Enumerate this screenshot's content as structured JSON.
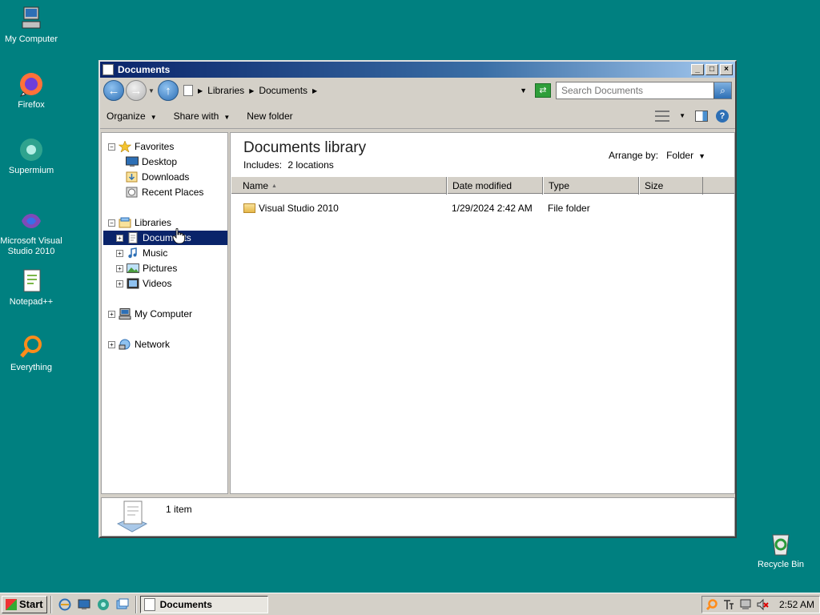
{
  "desktop": {
    "icons": [
      {
        "label": "My Computer"
      },
      {
        "label": "Firefox"
      },
      {
        "label": "Supermium"
      },
      {
        "label": "Microsoft Visual Studio 2010"
      },
      {
        "label": "Notepad++"
      },
      {
        "label": "Everything"
      },
      {
        "label": "Recycle Bin"
      }
    ]
  },
  "window": {
    "title": "Documents",
    "address": {
      "crumbs": [
        "Libraries",
        "Documents"
      ]
    },
    "search": {
      "placeholder": "Search Documents"
    },
    "toolbar": {
      "organize": "Organize",
      "share_with": "Share with",
      "new_folder": "New folder"
    },
    "nav": {
      "favorites": "Favorites",
      "desktop": "Desktop",
      "downloads": "Downloads",
      "recent_places": "Recent Places",
      "libraries": "Libraries",
      "documents": "Documents",
      "music": "Music",
      "pictures": "Pictures",
      "videos": "Videos",
      "my_computer": "My Computer",
      "network": "Network"
    },
    "content": {
      "title": "Documents library",
      "includes_label": "Includes:",
      "includes_link": "2 locations",
      "arrange_label": "Arrange by:",
      "arrange_value": "Folder",
      "columns": [
        "Name",
        "Date modified",
        "Type",
        "Size"
      ],
      "rows": [
        {
          "name": "Visual Studio 2010",
          "date": "1/29/2024 2:42 AM",
          "type": "File folder",
          "size": ""
        }
      ]
    },
    "details": {
      "count": "1 item"
    }
  },
  "taskbar": {
    "start": "Start",
    "task": "Documents",
    "clock": "2:52 AM"
  },
  "colors": {
    "desktop": "#008080",
    "selection": "#0a246a",
    "title_start": "#0a246a"
  }
}
